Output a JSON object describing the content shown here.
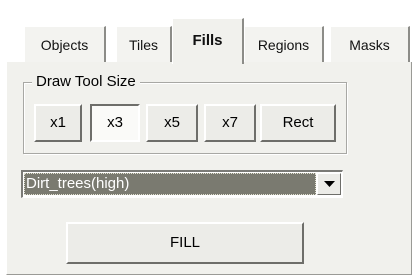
{
  "tabs": [
    {
      "label": "Objects"
    },
    {
      "label": "Tiles"
    },
    {
      "label": "Fills",
      "active": true
    },
    {
      "label": "Regions"
    },
    {
      "label": "Masks"
    }
  ],
  "draw_tool_size": {
    "label": "Draw Tool Size",
    "buttons": [
      {
        "label": "x1"
      },
      {
        "label": "x3",
        "pressed": true
      },
      {
        "label": "x5"
      },
      {
        "label": "x7"
      },
      {
        "label": "Rect"
      }
    ]
  },
  "fill_select": {
    "value": "Dirt_trees(high)",
    "arrow_icon": "chevron-down-icon"
  },
  "fill_button": {
    "label": "FILL"
  },
  "colors": {
    "panel": "#f1f1ed",
    "selection": "#7a7a70"
  }
}
